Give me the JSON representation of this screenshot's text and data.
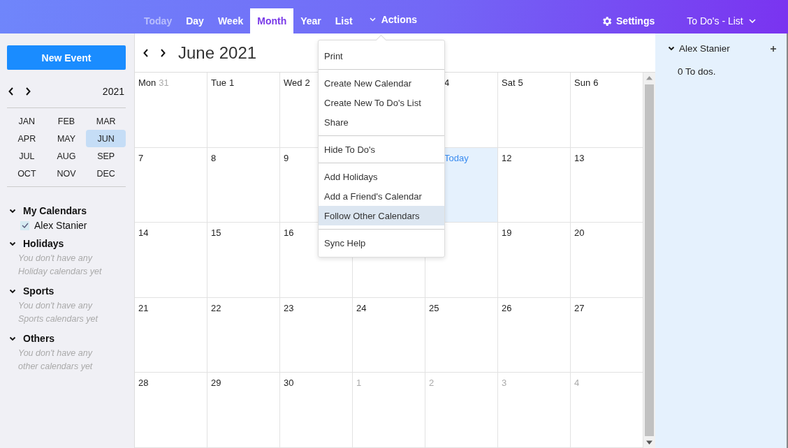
{
  "header": {
    "tabs": [
      {
        "label": "Today",
        "selected": false,
        "disabled": true
      },
      {
        "label": "Day",
        "selected": false,
        "disabled": false
      },
      {
        "label": "Week",
        "selected": false,
        "disabled": false
      },
      {
        "label": "Month",
        "selected": true,
        "disabled": false
      },
      {
        "label": "Year",
        "selected": false,
        "disabled": false
      },
      {
        "label": "List",
        "selected": false,
        "disabled": false
      }
    ],
    "actions": {
      "label": "Actions",
      "expanded": true
    },
    "settings": "Settings",
    "todo_menu": "To Do's - List"
  },
  "sidebar": {
    "new_event": "New Event",
    "year": "2021",
    "months": [
      {
        "label": "JAN",
        "selected": false
      },
      {
        "label": "FEB",
        "selected": false
      },
      {
        "label": "MAR",
        "selected": false
      },
      {
        "label": "APR",
        "selected": false
      },
      {
        "label": "MAY",
        "selected": false
      },
      {
        "label": "JUN",
        "selected": true
      },
      {
        "label": "JUL",
        "selected": false
      },
      {
        "label": "AUG",
        "selected": false
      },
      {
        "label": "SEP",
        "selected": false
      },
      {
        "label": "OCT",
        "selected": false
      },
      {
        "label": "NOV",
        "selected": false
      },
      {
        "label": "DEC",
        "selected": false
      }
    ],
    "groups": [
      {
        "title": "My Calendars",
        "expanded": true,
        "calendars": [
          {
            "name": "Alex Stanier",
            "checked": true
          }
        ]
      },
      {
        "title": "Holidays",
        "expanded": true,
        "empty_text": "You don't have any Holiday calendars yet"
      },
      {
        "title": "Sports",
        "expanded": true,
        "empty_text": "You don't have any Sports calendars yet"
      },
      {
        "title": "Others",
        "expanded": true,
        "empty_text": "You don't have any other calendars yet"
      }
    ]
  },
  "calendar": {
    "title": "June 2021",
    "weeks": [
      [
        {
          "weekday": "Mon",
          "label": "31",
          "other_month": true,
          "today": false
        },
        {
          "weekday": "Tue",
          "label": "1",
          "other_month": false,
          "today": false
        },
        {
          "weekday": "Wed",
          "label": "2",
          "other_month": false,
          "today": false
        },
        {
          "label": "4",
          "other_month": false,
          "today": false
        },
        {
          "weekday": "Sat",
          "label": "5",
          "other_month": false,
          "today": false
        },
        {
          "weekday": "Sun",
          "label": "6",
          "other_month": false,
          "today": false
        }
      ],
      [
        {
          "label": "7",
          "other_month": false,
          "today": false
        },
        {
          "label": "8",
          "other_month": false,
          "today": false
        },
        {
          "label": "9",
          "other_month": false,
          "today": false
        },
        {
          "label": "Today",
          "other_month": false,
          "today": true
        },
        {
          "label": "12",
          "other_month": false,
          "today": false
        },
        {
          "label": "13",
          "other_month": false,
          "today": false
        }
      ],
      [
        {
          "label": "14",
          "other_month": false,
          "today": false
        },
        {
          "label": "15",
          "other_month": false,
          "today": false
        },
        {
          "label": "16",
          "other_month": false,
          "today": false
        },
        {
          "today": false
        },
        {
          "today": false
        },
        {
          "label": "19",
          "other_month": false,
          "today": false
        },
        {
          "label": "20",
          "other_month": false,
          "today": false
        }
      ],
      [
        {
          "label": "21",
          "other_month": false,
          "today": false
        },
        {
          "label": "22",
          "other_month": false,
          "today": false
        },
        {
          "label": "23",
          "other_month": false,
          "today": false
        },
        {
          "label": "24",
          "other_month": false,
          "today": false
        },
        {
          "label": "25",
          "other_month": false,
          "today": false
        },
        {
          "label": "26",
          "other_month": false,
          "today": false
        },
        {
          "label": "27",
          "other_month": false,
          "today": false
        }
      ],
      [
        {
          "label": "28",
          "other_month": false,
          "today": false
        },
        {
          "label": "29",
          "other_month": false,
          "today": false
        },
        {
          "label": "30",
          "other_month": false,
          "today": false
        },
        {
          "label": "1",
          "other_month": true,
          "today": false
        },
        {
          "label": "2",
          "other_month": true,
          "today": false
        },
        {
          "label": "3",
          "other_month": true,
          "today": false
        },
        {
          "label": "4",
          "other_month": true,
          "today": false
        }
      ]
    ]
  },
  "actions_menu": {
    "groups": [
      [
        {
          "label": "Print",
          "selected": false
        }
      ],
      [
        {
          "label": "Create New Calendar",
          "selected": false
        },
        {
          "label": "Create New To Do's List",
          "selected": false
        },
        {
          "label": "Share",
          "selected": false
        }
      ],
      [
        {
          "label": "Hide To Do's",
          "selected": false
        }
      ],
      [
        {
          "label": "Add Holidays",
          "selected": false
        },
        {
          "label": "Add a Friend's Calendar",
          "selected": false
        },
        {
          "label": "Follow Other Calendars",
          "selected": true
        }
      ],
      [
        {
          "label": "Sync Help",
          "selected": false
        }
      ]
    ]
  },
  "todos": {
    "owner": "Alex Stanier",
    "expanded": true,
    "count_text": "0 To dos."
  }
}
